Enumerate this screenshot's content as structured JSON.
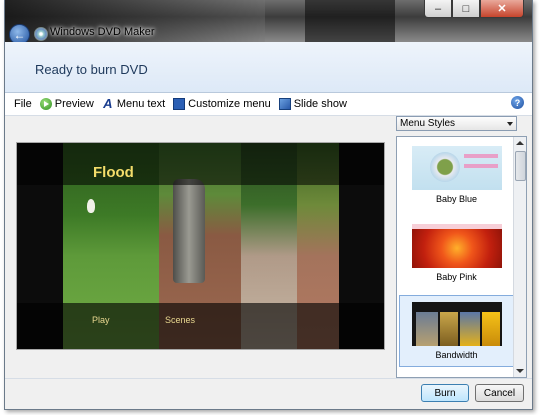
{
  "window": {
    "title": "Windows DVD Maker",
    "controls": {
      "minimize": "–",
      "maximize": "□",
      "close": "✕"
    }
  },
  "header": {
    "title": "Ready to burn DVD"
  },
  "toolbar": {
    "file": "File",
    "preview": "Preview",
    "menu_text": "Menu text",
    "customize_menu": "Customize menu",
    "slide_show": "Slide show",
    "help": "?"
  },
  "dvd_menu": {
    "title": "Flood",
    "play": "Play",
    "scenes": "Scenes"
  },
  "styles": {
    "dropdown_value": "Menu Styles",
    "items": [
      {
        "label": "Baby Blue",
        "selected": false
      },
      {
        "label": "Baby Pink",
        "selected": false
      },
      {
        "label": "Bandwidth",
        "selected": true
      }
    ]
  },
  "footer": {
    "burn": "Burn",
    "cancel": "Cancel"
  }
}
